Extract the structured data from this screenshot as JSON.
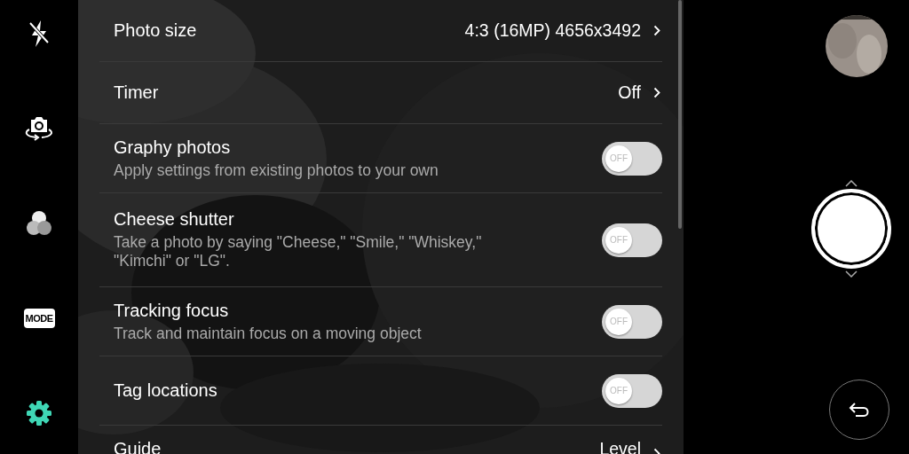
{
  "sidebar": {
    "items": [
      {
        "kind": "flash",
        "selected": false
      },
      {
        "kind": "switch-camera",
        "selected": false
      },
      {
        "kind": "filter",
        "selected": false
      },
      {
        "kind": "mode",
        "label": "MODE",
        "selected": false
      },
      {
        "kind": "settings",
        "selected": true
      }
    ]
  },
  "settings": [
    {
      "kind": "value",
      "title": "Photo size",
      "value": "4:3 (16MP) 4656x3492"
    },
    {
      "kind": "value",
      "title": "Timer",
      "value": "Off"
    },
    {
      "kind": "toggle",
      "title": "Graphy photos",
      "description": "Apply settings from existing photos to your own",
      "on": false,
      "toggle_label": "OFF"
    },
    {
      "kind": "toggle",
      "title": "Cheese shutter",
      "description": "Take a photo by saying \"Cheese,\" \"Smile,\" \"Whiskey,\" \"Kimchi\" or \"LG\".",
      "on": false,
      "toggle_label": "OFF"
    },
    {
      "kind": "toggle",
      "title": "Tracking focus",
      "description": "Track and maintain focus on a moving object",
      "on": false,
      "toggle_label": "OFF"
    },
    {
      "kind": "toggle",
      "title": "Tag locations",
      "on": false,
      "toggle_label": "OFF"
    },
    {
      "kind": "value",
      "title": "Guide",
      "value": "Level"
    }
  ]
}
